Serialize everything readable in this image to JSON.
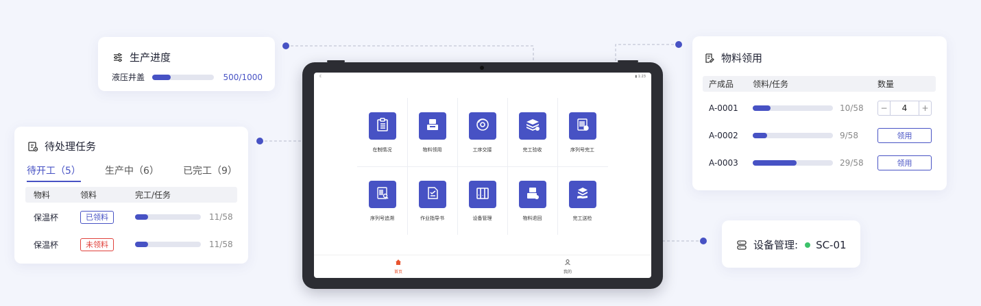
{
  "colors": {
    "accent": "#4752c4",
    "danger": "#e0403a",
    "bg": "#f3f5fc",
    "track": "#e3e5ef",
    "online": "#3cc26a"
  },
  "progress_card": {
    "title": "生产进度",
    "icon": "sliders-icon",
    "item_name": "液压井盖",
    "value_text": "500/1000",
    "fraction": 0.3
  },
  "tasks_card": {
    "title": "待处理任务",
    "icon": "task-list-icon",
    "tabs": [
      {
        "label": "待开工（5）",
        "active": true
      },
      {
        "label": "生产中（6）",
        "active": false
      },
      {
        "label": "已完工（9）",
        "active": false
      }
    ],
    "headers": [
      "物料",
      "领料",
      "完工/任务"
    ],
    "rows": [
      {
        "material": "保温杯",
        "status": "已领料",
        "status_type": "done",
        "count": "11/58",
        "fraction": 0.2
      },
      {
        "material": "保温杯",
        "status": "未领料",
        "status_type": "pending",
        "count": "11/58",
        "fraction": 0.2
      }
    ]
  },
  "material_card": {
    "title": "物料领用",
    "icon": "edit-doc-icon",
    "headers": [
      "产成品",
      "领料/任务",
      "数量"
    ],
    "rows": [
      {
        "product": "A-0001",
        "count": "10/58",
        "fraction": 0.22,
        "qty": "4",
        "minus": "−",
        "plus": "+"
      },
      {
        "product": "A-0002",
        "count": "9/58",
        "fraction": 0.18,
        "action": "领用"
      },
      {
        "product": "A-0003",
        "count": "29/58",
        "fraction": 0.55,
        "action": "领用"
      }
    ]
  },
  "device_card": {
    "icon": "server-icon",
    "label": "设备管理:",
    "status_icon": "online-dot-icon",
    "value": "SC-01"
  },
  "tablet": {
    "status_left": "ℂ",
    "status_right": "▮ 1:23",
    "tiles": [
      {
        "label": "在制情况",
        "icon": "clipboard-list-icon"
      },
      {
        "label": "物料领用",
        "icon": "tray-icon"
      },
      {
        "label": "工序交接",
        "icon": "process-cycle-icon"
      },
      {
        "label": "完工验收",
        "icon": "layers-check-icon"
      },
      {
        "label": "序列号完工",
        "icon": "barcode-check-icon"
      },
      {
        "label": "序列号追溯",
        "icon": "barcode-search-icon"
      },
      {
        "label": "作业指导书",
        "icon": "instruction-doc-icon"
      },
      {
        "label": "设备管理",
        "icon": "equipment-icon"
      },
      {
        "label": "物料退回",
        "icon": "return-tray-icon"
      },
      {
        "label": "完工送检",
        "icon": "inspection-hand-icon"
      }
    ],
    "tabbar": [
      {
        "label": "首页",
        "icon": "home-icon",
        "active": true
      },
      {
        "label": "我的",
        "icon": "user-icon",
        "active": false
      }
    ]
  }
}
